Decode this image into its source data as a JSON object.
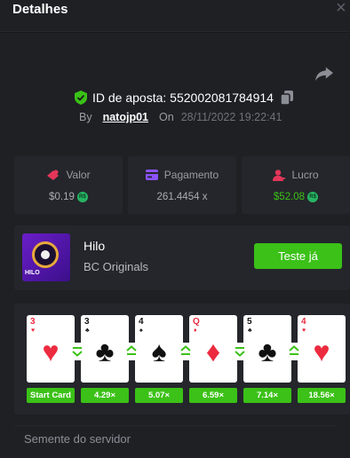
{
  "header": {
    "title": "Detalhes",
    "close_glyph": "×"
  },
  "bet": {
    "id_label": "ID de aposta:",
    "id_value": "552002081784914",
    "by_label": "By",
    "username": "natojp01",
    "on_label": "On",
    "datetime": "28/11/2022 19:22:41"
  },
  "stats": [
    {
      "label": "Valor",
      "value": "$0.19",
      "icon": "bet-amount-icon",
      "color": "#e3365a"
    },
    {
      "label": "Pagamento",
      "value": "261.4454 x",
      "icon": "payout-card-icon",
      "color": "#8c52ff"
    },
    {
      "label": "Lucro",
      "value": "$52.08",
      "icon": "profit-user-icon",
      "color": "#e3365a",
      "value_color": "#3bc117"
    }
  ],
  "coin_label": "R$",
  "game": {
    "name": "Hilo",
    "provider": "BC Originals",
    "thumb_label": "HILO",
    "play_label": "Teste já"
  },
  "cards": [
    {
      "rank": "3",
      "suit": "♥",
      "color": "red",
      "guess": null,
      "multiplier": "Start Card"
    },
    {
      "rank": "3",
      "suit": "♣",
      "color": "blk",
      "guess": "lower",
      "multiplier": "4.29×"
    },
    {
      "rank": "4",
      "suit": "♠",
      "color": "blk",
      "guess": "higher",
      "multiplier": "5.07×"
    },
    {
      "rank": "Q",
      "suit": "♦",
      "color": "red",
      "guess": "higher",
      "multiplier": "6.59×"
    },
    {
      "rank": "5",
      "suit": "♣",
      "color": "blk",
      "guess": "lower",
      "multiplier": "7.14×"
    },
    {
      "rank": "4",
      "suit": "♥",
      "color": "red",
      "guess": "higher",
      "multiplier": "18.56×"
    }
  ],
  "seed": {
    "label": "Semente do servidor"
  }
}
